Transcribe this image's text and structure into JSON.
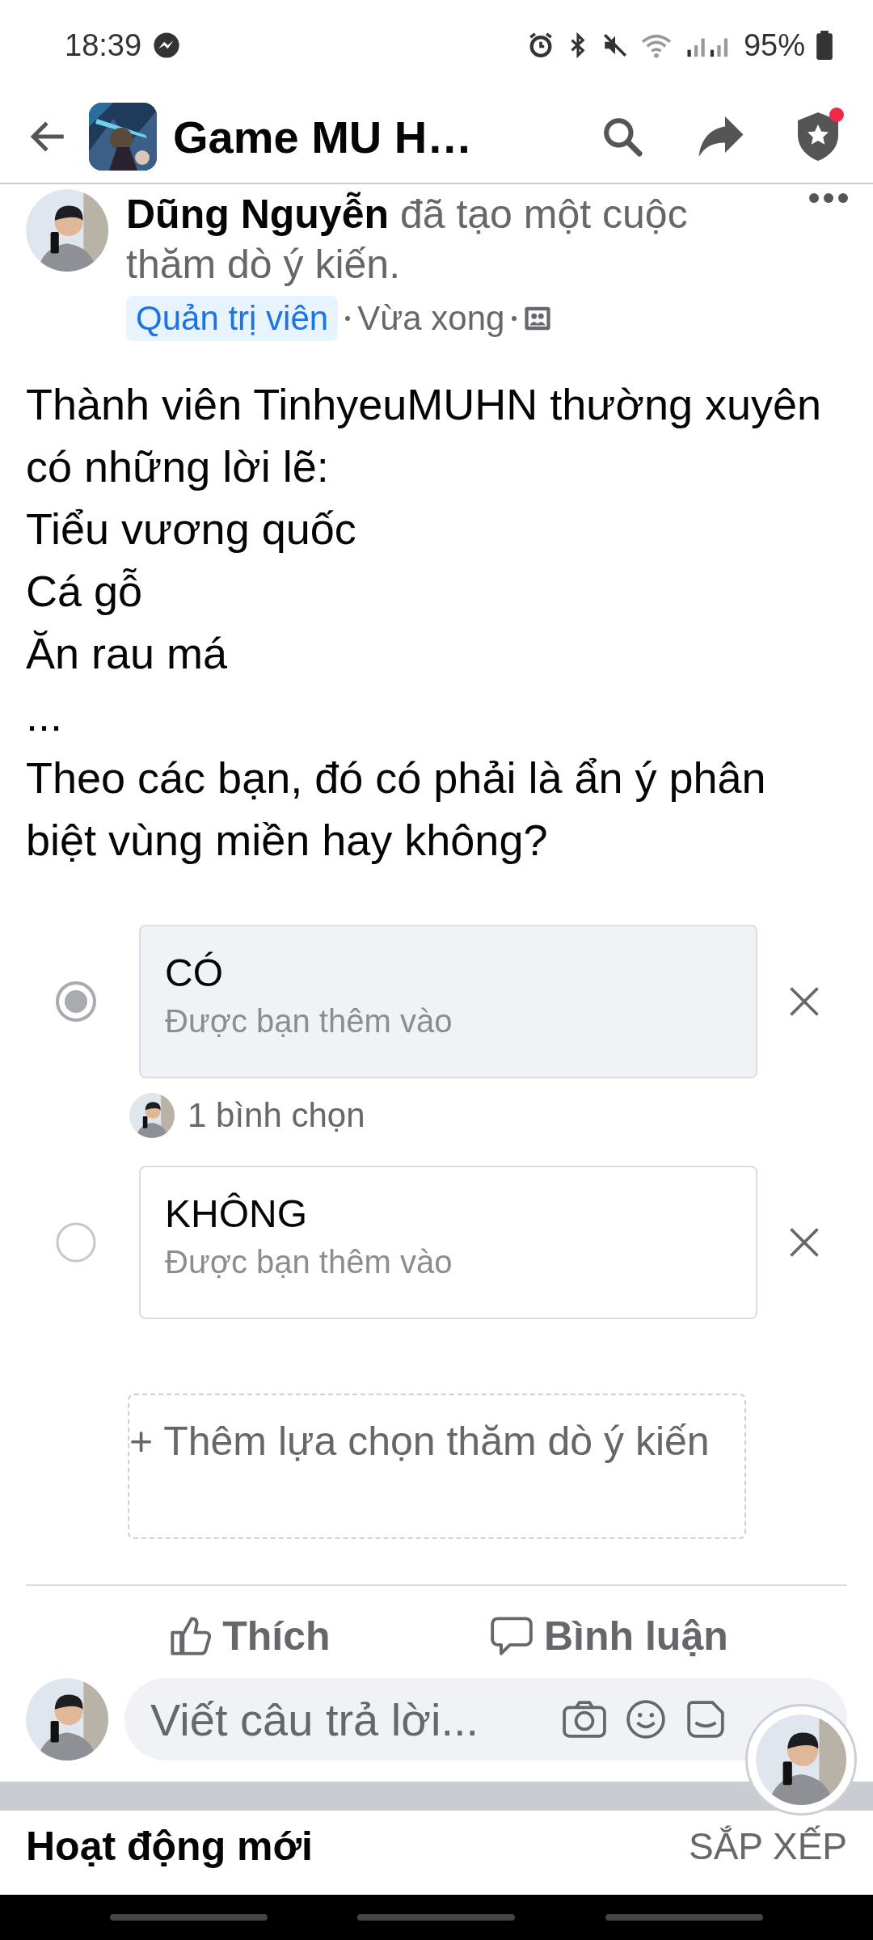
{
  "status_bar": {
    "time": "18:39",
    "battery": "95%"
  },
  "header": {
    "title": "Game MU H…",
    "notification": true
  },
  "post": {
    "headline": "**Dũng Nguyễn** đã tạo một cuộc thăm dò ý kiến.",
    "badge": "Quản trị viên",
    "time": "Vừa xong",
    "text_lines": [
      "Thành viên TinhyeuMUHN thường xuyên có những lời lẽ:",
      "Tiểu vương quốc",
      "Cá gỗ",
      "Ăn rau má",
      "...",
      "Theo các bạn, đó có phải là ẩn ý phân biệt vùng miền hay không?"
    ]
  },
  "poll": {
    "options": [
      {
        "label": "CÓ",
        "note": "Được bạn thêm vào",
        "selected": true,
        "votes": "1 bình chọn"
      },
      {
        "label": "KHÔNG",
        "note": "Được bạn thêm vào",
        "selected": false
      }
    ],
    "add_option": "+ Thêm lựa chọn thăm dò ý kiến"
  },
  "actions": [
    {
      "kind": "like",
      "label": "Thích"
    },
    {
      "kind": "comment",
      "label": "Bình luận"
    }
  ],
  "comment_field": {
    "placeholder": "Viết câu trả lời..."
  },
  "activity": {
    "title": "Hoạt động mới",
    "sort": "SẮP XẾP"
  }
}
